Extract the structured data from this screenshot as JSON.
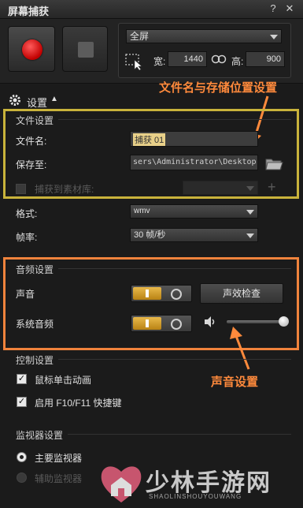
{
  "window": {
    "title": "屏幕捕获",
    "help": "?",
    "close": "✕"
  },
  "region": {
    "mode": "全屏",
    "width_label": "宽:",
    "width": "1440",
    "height_label": "高:",
    "height": "900"
  },
  "settings": {
    "label": "设置",
    "toggle_arrow": "▲"
  },
  "annotations": {
    "file_note": "文件名与存储位置设置",
    "audio_note": "声音设置"
  },
  "file_settings": {
    "title": "文件设置",
    "name_label": "文件名:",
    "name_value": "捕获 01",
    "save_label": "保存至:",
    "save_path": "sers\\Administrator\\Desktop",
    "capture_to_library": "捕获到素材库:"
  },
  "format": {
    "label": "格式:",
    "value": "wmv"
  },
  "framerate": {
    "label": "帧率:",
    "value": "30 帧/秒"
  },
  "audio_settings": {
    "title": "音频设置",
    "voice_label": "声音",
    "check_button": "声效检查",
    "system_audio_label": "系统音频",
    "volume": 1.0
  },
  "control_settings": {
    "title": "控制设置",
    "mouse_click_anim": "鼠标单击动画",
    "hotkeys": "启用 F10/F11 快捷键"
  },
  "monitor_settings": {
    "title": "监视器设置",
    "primary": "主要监视器",
    "secondary": "辅助监视器"
  },
  "watermark": {
    "text": "少林手游网",
    "subtext": "SHAOLINSHOUYOUWANG"
  },
  "colors": {
    "highlight_yellow": "#c9b33b",
    "highlight_orange": "#f0833c",
    "record_red": "#d10000",
    "toggle_on": "#e0a83a"
  }
}
